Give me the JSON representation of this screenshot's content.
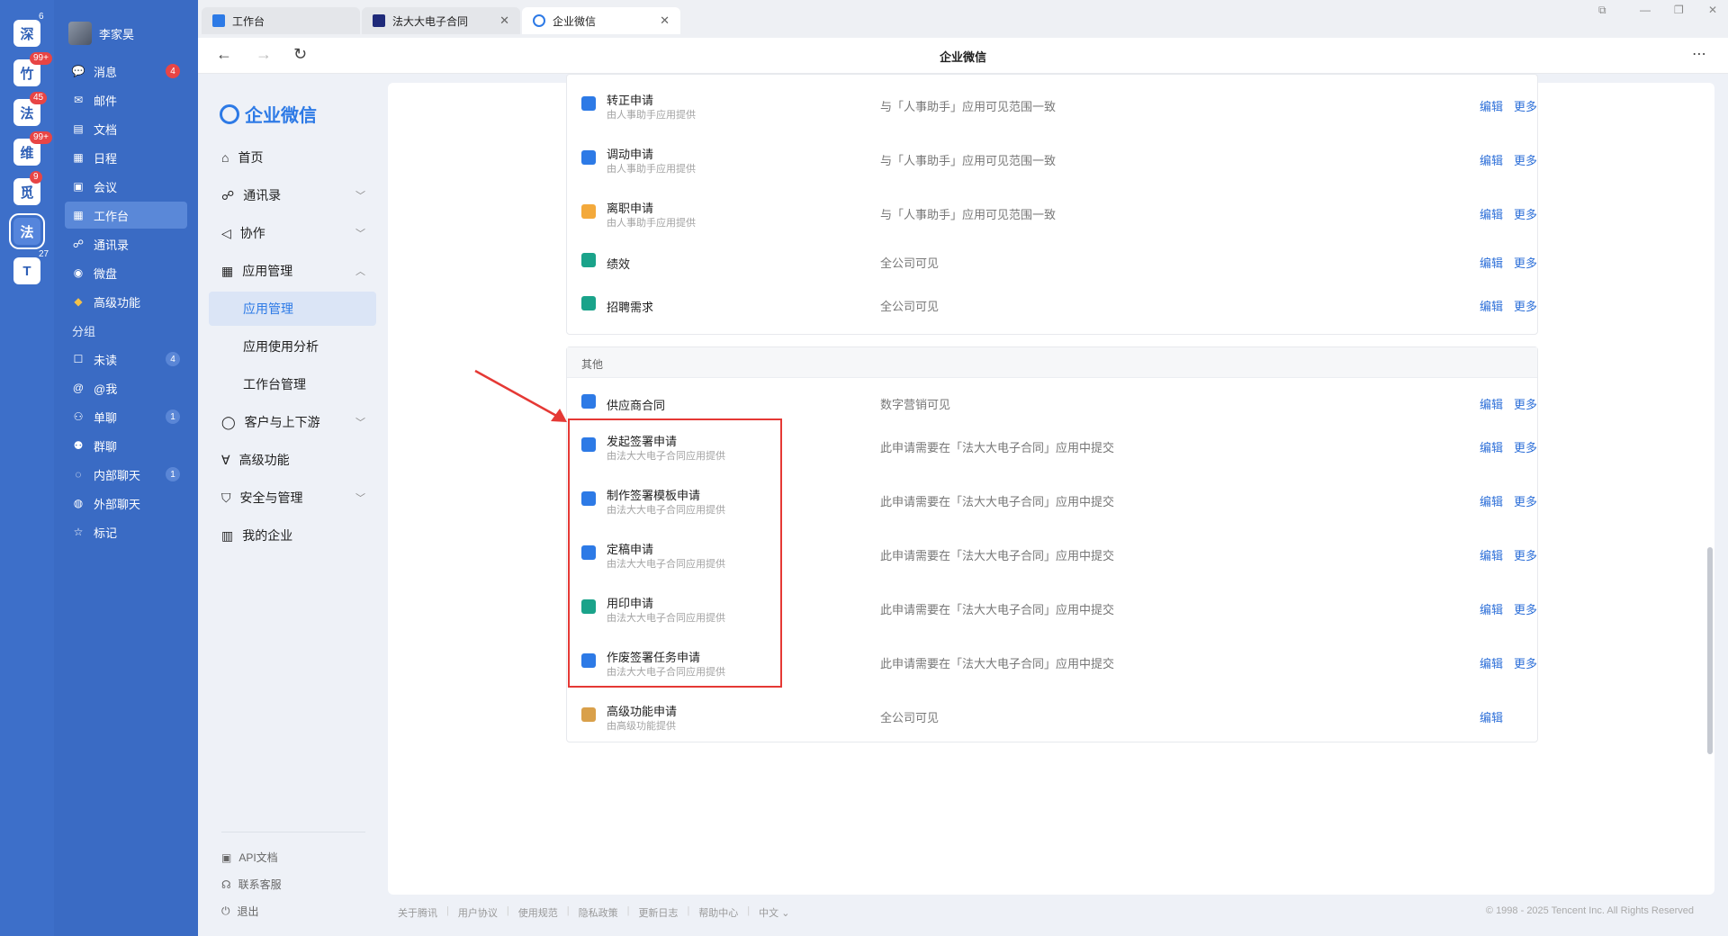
{
  "rail": [
    {
      "label": "深",
      "badge": "6",
      "plain": true
    },
    {
      "label": "竹",
      "badge": "99+"
    },
    {
      "label": "法",
      "badge": "45"
    },
    {
      "label": "维",
      "badge": "99+"
    },
    {
      "label": "觅",
      "badge": "9"
    },
    {
      "label": "法",
      "badge": ""
    },
    {
      "label": "T",
      "badge": "27",
      "plain": true
    }
  ],
  "nav": {
    "user": "李家昊",
    "items": [
      {
        "label": "消息",
        "badge": "4"
      },
      {
        "label": "邮件",
        "badge": ""
      },
      {
        "label": "文档",
        "badge": ""
      },
      {
        "label": "日程",
        "badge": ""
      },
      {
        "label": "会议",
        "badge": ""
      },
      {
        "label": "工作台",
        "badge": ""
      },
      {
        "label": "通讯录",
        "badge": ""
      },
      {
        "label": "微盘",
        "badge": ""
      },
      {
        "label": "高级功能",
        "badge": ""
      }
    ],
    "group_label": "分组",
    "group_items": [
      {
        "label": "未读",
        "badge": "4"
      },
      {
        "label": "@我",
        "badge": ""
      },
      {
        "label": "单聊",
        "badge": "1"
      },
      {
        "label": "群聊",
        "badge": ""
      },
      {
        "label": "内部聊天",
        "badge": "1"
      },
      {
        "label": "外部聊天",
        "badge": ""
      },
      {
        "label": "标记",
        "badge": ""
      }
    ]
  },
  "tabs": [
    {
      "label": "工作台"
    },
    {
      "label": "法大大电子合同"
    },
    {
      "label": "企业微信"
    }
  ],
  "address": {
    "title": "企业微信",
    "more": "⋯"
  },
  "sidebar": {
    "brand": "企业微信",
    "items": [
      {
        "label": "首页"
      },
      {
        "label": "通讯录"
      },
      {
        "label": "协作"
      },
      {
        "label": "应用管理"
      },
      {
        "label": "应用管理"
      },
      {
        "label": "应用使用分析"
      },
      {
        "label": "工作台管理"
      },
      {
        "label": "客户与上下游"
      },
      {
        "label": "高级功能"
      },
      {
        "label": "安全与管理"
      },
      {
        "label": "我的企业"
      }
    ],
    "footer": [
      {
        "label": "API文档"
      },
      {
        "label": "联系客服"
      },
      {
        "label": "退出"
      }
    ]
  },
  "actions": {
    "edit": "编辑",
    "more": "更多"
  },
  "card1": {
    "rows": [
      {
        "name": "转正申请",
        "sub": "由人事助手应用提供",
        "vis": "与「人事助手」应用可见范围一致",
        "color": "#2d7ae6"
      },
      {
        "name": "调动申请",
        "sub": "由人事助手应用提供",
        "vis": "与「人事助手」应用可见范围一致",
        "color": "#2d7ae6"
      },
      {
        "name": "离职申请",
        "sub": "由人事助手应用提供",
        "vis": "与「人事助手」应用可见范围一致",
        "color": "#f3a93b"
      },
      {
        "name": "绩效",
        "sub": "",
        "vis": "全公司可见",
        "color": "#1aa38a"
      },
      {
        "name": "招聘需求",
        "sub": "",
        "vis": "全公司可见",
        "color": "#1aa38a"
      }
    ]
  },
  "card2": {
    "header": "其他",
    "rows": [
      {
        "name": "供应商合同",
        "sub": "",
        "vis": "数字营销可见",
        "color": "#2d7ae6"
      },
      {
        "name": "发起签署申请",
        "sub": "由法大大电子合同应用提供",
        "vis": "此申请需要在「法大大电子合同」应用中提交",
        "color": "#2d7ae6"
      },
      {
        "name": "制作签署模板申请",
        "sub": "由法大大电子合同应用提供",
        "vis": "此申请需要在「法大大电子合同」应用中提交",
        "color": "#2d7ae6"
      },
      {
        "name": "定稿申请",
        "sub": "由法大大电子合同应用提供",
        "vis": "此申请需要在「法大大电子合同」应用中提交",
        "color": "#2d7ae6"
      },
      {
        "name": "用印申请",
        "sub": "由法大大电子合同应用提供",
        "vis": "此申请需要在「法大大电子合同」应用中提交",
        "color": "#1aa38a"
      },
      {
        "name": "作废签署任务申请",
        "sub": "由法大大电子合同应用提供",
        "vis": "此申请需要在「法大大电子合同」应用中提交",
        "color": "#2d7ae6"
      },
      {
        "name": "高级功能申请",
        "sub": "由高级功能提供",
        "vis": "全公司可见",
        "color": "#d9a04a"
      }
    ]
  },
  "footer_links": [
    "关于腾讯",
    "用户协议",
    "使用规范",
    "隐私政策",
    "更新日志",
    "帮助中心",
    "中文 ⌄"
  ],
  "copyright": "© 1998 - 2025 Tencent Inc. All Rights Reserved",
  "colors": {
    "accent": "#2d7ae6",
    "highlight": "#e53935",
    "nav_bg": "#3a6bc4"
  }
}
